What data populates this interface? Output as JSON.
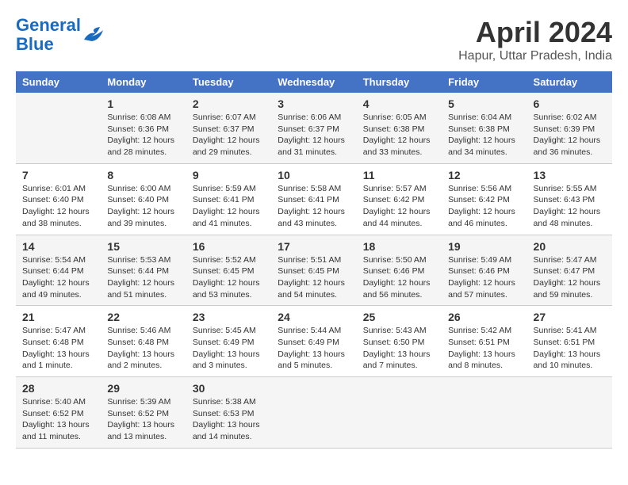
{
  "logo": {
    "general": "General",
    "blue": "Blue"
  },
  "title": "April 2024",
  "location": "Hapur, Uttar Pradesh, India",
  "days_of_week": [
    "Sunday",
    "Monday",
    "Tuesday",
    "Wednesday",
    "Thursday",
    "Friday",
    "Saturday"
  ],
  "weeks": [
    [
      {
        "day": "",
        "info": ""
      },
      {
        "day": "1",
        "info": "Sunrise: 6:08 AM\nSunset: 6:36 PM\nDaylight: 12 hours\nand 28 minutes."
      },
      {
        "day": "2",
        "info": "Sunrise: 6:07 AM\nSunset: 6:37 PM\nDaylight: 12 hours\nand 29 minutes."
      },
      {
        "day": "3",
        "info": "Sunrise: 6:06 AM\nSunset: 6:37 PM\nDaylight: 12 hours\nand 31 minutes."
      },
      {
        "day": "4",
        "info": "Sunrise: 6:05 AM\nSunset: 6:38 PM\nDaylight: 12 hours\nand 33 minutes."
      },
      {
        "day": "5",
        "info": "Sunrise: 6:04 AM\nSunset: 6:38 PM\nDaylight: 12 hours\nand 34 minutes."
      },
      {
        "day": "6",
        "info": "Sunrise: 6:02 AM\nSunset: 6:39 PM\nDaylight: 12 hours\nand 36 minutes."
      }
    ],
    [
      {
        "day": "7",
        "info": "Sunrise: 6:01 AM\nSunset: 6:40 PM\nDaylight: 12 hours\nand 38 minutes."
      },
      {
        "day": "8",
        "info": "Sunrise: 6:00 AM\nSunset: 6:40 PM\nDaylight: 12 hours\nand 39 minutes."
      },
      {
        "day": "9",
        "info": "Sunrise: 5:59 AM\nSunset: 6:41 PM\nDaylight: 12 hours\nand 41 minutes."
      },
      {
        "day": "10",
        "info": "Sunrise: 5:58 AM\nSunset: 6:41 PM\nDaylight: 12 hours\nand 43 minutes."
      },
      {
        "day": "11",
        "info": "Sunrise: 5:57 AM\nSunset: 6:42 PM\nDaylight: 12 hours\nand 44 minutes."
      },
      {
        "day": "12",
        "info": "Sunrise: 5:56 AM\nSunset: 6:42 PM\nDaylight: 12 hours\nand 46 minutes."
      },
      {
        "day": "13",
        "info": "Sunrise: 5:55 AM\nSunset: 6:43 PM\nDaylight: 12 hours\nand 48 minutes."
      }
    ],
    [
      {
        "day": "14",
        "info": "Sunrise: 5:54 AM\nSunset: 6:44 PM\nDaylight: 12 hours\nand 49 minutes."
      },
      {
        "day": "15",
        "info": "Sunrise: 5:53 AM\nSunset: 6:44 PM\nDaylight: 12 hours\nand 51 minutes."
      },
      {
        "day": "16",
        "info": "Sunrise: 5:52 AM\nSunset: 6:45 PM\nDaylight: 12 hours\nand 53 minutes."
      },
      {
        "day": "17",
        "info": "Sunrise: 5:51 AM\nSunset: 6:45 PM\nDaylight: 12 hours\nand 54 minutes."
      },
      {
        "day": "18",
        "info": "Sunrise: 5:50 AM\nSunset: 6:46 PM\nDaylight: 12 hours\nand 56 minutes."
      },
      {
        "day": "19",
        "info": "Sunrise: 5:49 AM\nSunset: 6:46 PM\nDaylight: 12 hours\nand 57 minutes."
      },
      {
        "day": "20",
        "info": "Sunrise: 5:47 AM\nSunset: 6:47 PM\nDaylight: 12 hours\nand 59 minutes."
      }
    ],
    [
      {
        "day": "21",
        "info": "Sunrise: 5:47 AM\nSunset: 6:48 PM\nDaylight: 13 hours\nand 1 minute."
      },
      {
        "day": "22",
        "info": "Sunrise: 5:46 AM\nSunset: 6:48 PM\nDaylight: 13 hours\nand 2 minutes."
      },
      {
        "day": "23",
        "info": "Sunrise: 5:45 AM\nSunset: 6:49 PM\nDaylight: 13 hours\nand 3 minutes."
      },
      {
        "day": "24",
        "info": "Sunrise: 5:44 AM\nSunset: 6:49 PM\nDaylight: 13 hours\nand 5 minutes."
      },
      {
        "day": "25",
        "info": "Sunrise: 5:43 AM\nSunset: 6:50 PM\nDaylight: 13 hours\nand 7 minutes."
      },
      {
        "day": "26",
        "info": "Sunrise: 5:42 AM\nSunset: 6:51 PM\nDaylight: 13 hours\nand 8 minutes."
      },
      {
        "day": "27",
        "info": "Sunrise: 5:41 AM\nSunset: 6:51 PM\nDaylight: 13 hours\nand 10 minutes."
      }
    ],
    [
      {
        "day": "28",
        "info": "Sunrise: 5:40 AM\nSunset: 6:52 PM\nDaylight: 13 hours\nand 11 minutes."
      },
      {
        "day": "29",
        "info": "Sunrise: 5:39 AM\nSunset: 6:52 PM\nDaylight: 13 hours\nand 13 minutes."
      },
      {
        "day": "30",
        "info": "Sunrise: 5:38 AM\nSunset: 6:53 PM\nDaylight: 13 hours\nand 14 minutes."
      },
      {
        "day": "",
        "info": ""
      },
      {
        "day": "",
        "info": ""
      },
      {
        "day": "",
        "info": ""
      },
      {
        "day": "",
        "info": ""
      }
    ]
  ]
}
